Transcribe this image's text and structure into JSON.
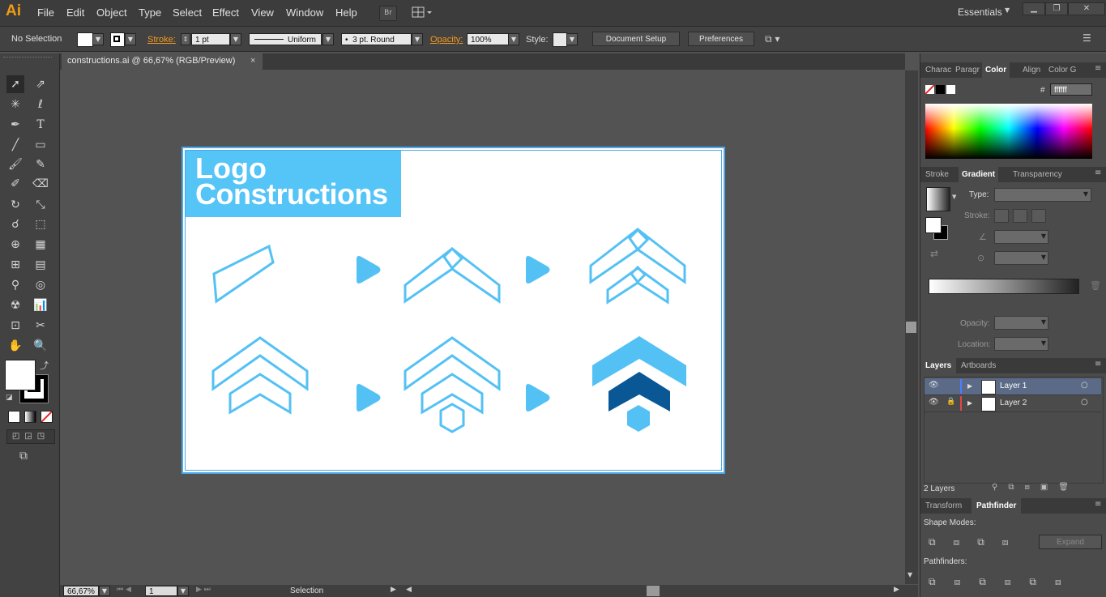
{
  "app": {
    "logo": "Ai"
  },
  "menu": [
    "File",
    "Edit",
    "Object",
    "Type",
    "Select",
    "Effect",
    "View",
    "Window",
    "Help"
  ],
  "bridge_label": "Br",
  "workspace": "Essentials",
  "control": {
    "selection": "No Selection",
    "stroke_label": "Stroke:",
    "stroke_value": "1 pt",
    "profile": "Uniform",
    "brush": "3 pt. Round",
    "opacity_label": "Opacity:",
    "opacity_value": "100%",
    "style_label": "Style:",
    "document_setup": "Document Setup",
    "preferences": "Preferences"
  },
  "document_tab": {
    "title": "constructions.ai @ 66,67% (RGB/Preview)",
    "close": "×"
  },
  "artboard": {
    "title_line1": "Logo",
    "title_line2": "Constructions",
    "colors": {
      "light": "#54c1f5",
      "dark": "#0a5796",
      "title_bg": "#55c4f7"
    }
  },
  "status": {
    "zoom": "66,67%",
    "artboard_num": "1",
    "tool": "Selection"
  },
  "panels": {
    "top_tabs": [
      "Charac",
      "Paragr",
      "Color",
      "Align",
      "Color G"
    ],
    "hex_label": "#",
    "hex_value": "ffffff",
    "mid_tabs": [
      "Stroke",
      "Gradient",
      "Transparency"
    ],
    "type_label": "Type:",
    "stroke_label": "Stroke:",
    "opacity_label": "Opacity:",
    "location_label": "Location:",
    "layers_tabs": [
      "Layers",
      "Artboards"
    ],
    "layers": [
      {
        "name": "Layer 1",
        "color": "#4f7cff"
      },
      {
        "name": "Layer 2",
        "color": "#e04848"
      }
    ],
    "layers_count": "2 Layers",
    "bottom_tabs": [
      "Transform",
      "Pathfinder"
    ],
    "shape_modes": "Shape Modes:",
    "expand": "Expand",
    "pathfinders": "Pathfinders:"
  }
}
